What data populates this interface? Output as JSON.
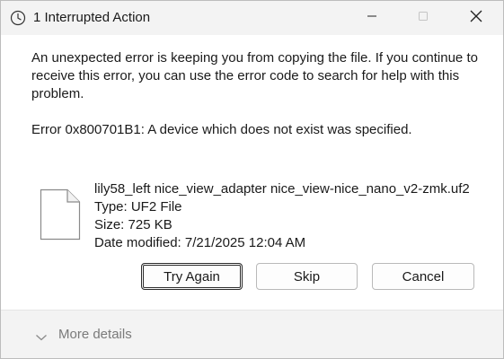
{
  "window": {
    "title": "1 Interrupted Action",
    "icons": {
      "app": "clock-icon",
      "minimize": "minimize-icon",
      "maximize": "maximize-icon",
      "close": "close-icon"
    }
  },
  "dialog": {
    "message": "An unexpected error is keeping you from copying the file. If you continue to receive this error, you can use the error code to search for help with this problem.",
    "error": "Error 0x800701B1: A device which does not exist was specified."
  },
  "file": {
    "icon": "file-icon",
    "name": "lily58_left nice_view_adapter nice_view-nice_nano_v2-zmk.uf2",
    "type": "Type: UF2 File",
    "size": "Size: 725 KB",
    "modified": "Date modified: 7/21/2025 12:04 AM"
  },
  "buttons": {
    "try_again": "Try Again",
    "skip": "Skip",
    "cancel": "Cancel"
  },
  "footer": {
    "more_details": "More details",
    "icon": "chevron-down-icon"
  },
  "colors": {
    "background": "#f3f3f3",
    "content": "#ffffff",
    "muted_text": "#7a7a7a",
    "focus_border": "#2b2b2b"
  }
}
